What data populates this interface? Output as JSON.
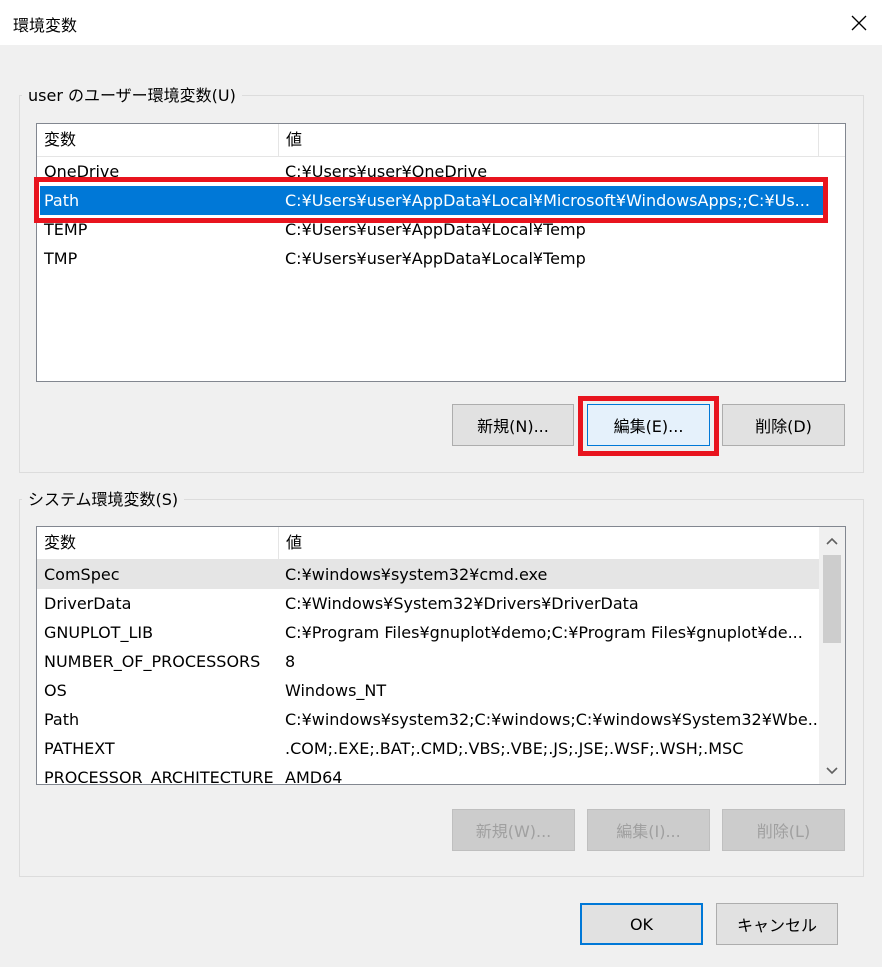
{
  "window": {
    "title": "環境変数"
  },
  "user_group": {
    "label": "user のユーザー環境変数(U)",
    "columns": [
      "変数",
      "値"
    ],
    "rows": [
      {
        "name": "OneDrive",
        "value": "C:¥Users¥user¥OneDrive"
      },
      {
        "name": "Path",
        "value": "C:¥Users¥user¥AppData¥Local¥Microsoft¥WindowsApps;;C:¥Us..."
      },
      {
        "name": "TEMP",
        "value": "C:¥Users¥user¥AppData¥Local¥Temp"
      },
      {
        "name": "TMP",
        "value": "C:¥Users¥user¥AppData¥Local¥Temp"
      }
    ],
    "selected_row": "Path",
    "buttons": {
      "new": "新規(N)...",
      "edit": "編集(E)...",
      "delete": "削除(D)"
    }
  },
  "system_group": {
    "label": "システム環境変数(S)",
    "columns": [
      "変数",
      "値"
    ],
    "rows": [
      {
        "name": "ComSpec",
        "value": "C:¥windows¥system32¥cmd.exe"
      },
      {
        "name": "DriverData",
        "value": "C:¥Windows¥System32¥Drivers¥DriverData"
      },
      {
        "name": "GNUPLOT_LIB",
        "value": "C:¥Program Files¥gnuplot¥demo;C:¥Program Files¥gnuplot¥de..."
      },
      {
        "name": "NUMBER_OF_PROCESSORS",
        "value": "8"
      },
      {
        "name": "OS",
        "value": "Windows_NT"
      },
      {
        "name": "Path",
        "value": "C:¥windows¥system32;C:¥windows;C:¥windows¥System32¥Wbe..."
      },
      {
        "name": "PATHEXT",
        "value": ".COM;.EXE;.BAT;.CMD;.VBS;.VBE;.JS;.JSE;.WSF;.WSH;.MSC"
      },
      {
        "name": "PROCESSOR_ARCHITECTURE",
        "value": "AMD64"
      }
    ],
    "buttons": {
      "new": "新規(W)...",
      "edit": "編集(I)...",
      "delete": "削除(L)"
    }
  },
  "footer": {
    "ok": "OK",
    "cancel": "キャンセル"
  },
  "colors": {
    "selection": "#0078d7",
    "highlight_box": "#e8141e"
  },
  "icons": {
    "close": "close-icon",
    "scroll_up": "chevron-up-icon",
    "scroll_down": "chevron-down-icon"
  }
}
